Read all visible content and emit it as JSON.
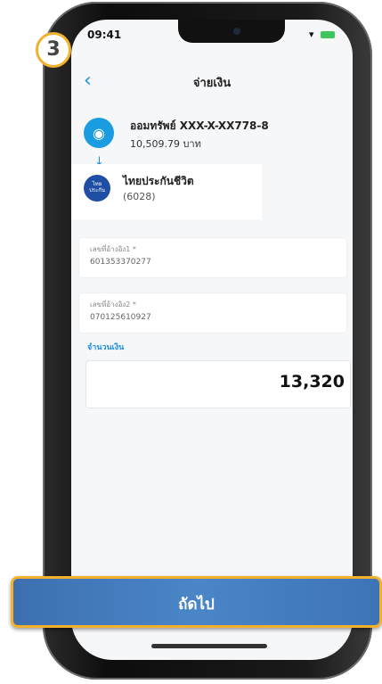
{
  "step_number": "3",
  "status_bar": {
    "time": "09:41",
    "signal": "▾ "
  },
  "header": {
    "title": "จ่ายเงิน"
  },
  "from_account": {
    "name": "ออมทรัพย์ XXX-X-XX778-8",
    "balance": "10,509.79 บาท"
  },
  "biller": {
    "name": "ไทยประกันชีวิต",
    "code": "(6028)",
    "logo_text": "ไทย ประกัน"
  },
  "references": [
    {
      "label": "เลขที่อ้างอิง1 *",
      "value": "601353370277"
    },
    {
      "label": "เลขที่อ้างอิง2 *",
      "value": "070125610927"
    }
  ],
  "amount": {
    "label": "จำนวนเงิน",
    "value": "13,320"
  },
  "next_button": {
    "label": "ถัดไป"
  },
  "colors": {
    "accent": "#1d8fe0",
    "badge_ring": "#f2b12c",
    "button": "#4a86c7"
  }
}
